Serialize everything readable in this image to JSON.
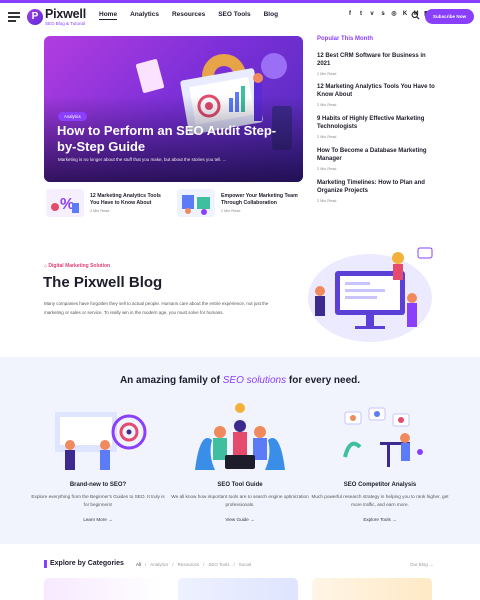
{
  "header": {
    "logo_letter": "P",
    "logo_name": "Pixwell",
    "logo_tagline": "SEO Blog & Tutorial",
    "nav": [
      "Home",
      "Analytics",
      "Resources",
      "SEO Tools",
      "Blog"
    ],
    "social_icons": [
      "facebook-icon",
      "twitter-icon",
      "vimeo-icon",
      "skype-icon",
      "instagram-icon",
      "vk-icon",
      "medium-icon",
      "grid-icon"
    ],
    "social_glyphs": [
      "f",
      "t",
      "v",
      "s",
      "◎",
      "K",
      "M",
      "▦"
    ],
    "subscribe_label": "Subscribe Now",
    "accent": "#8a3ffc"
  },
  "hero": {
    "tag": "Analytics",
    "title": "How to Perform an SEO Audit Step-by-Step Guide",
    "excerpt": "Marketing is no longer about the stuff that you make, but about the stories you tell. ..."
  },
  "mini_posts": [
    {
      "title": "12 Marketing Analytics Tools You Have to Know About",
      "meta": "2 Min Read"
    },
    {
      "title": "Empower Your Marketing Team Through Collaboration",
      "meta": "2 Min Read"
    }
  ],
  "popular": {
    "heading": "Popular This Month",
    "items": [
      {
        "title": "12 Best CRM Software for Business in 2021",
        "meta": "2 Min Read"
      },
      {
        "title": "12 Marketing Analytics Tools You Have to Know About",
        "meta": "2 Min Read"
      },
      {
        "title": "9 Habits of Highly Effective Marketing Technologists",
        "meta": "2 Min Read"
      },
      {
        "title": "How To Become a Database Marketing Manager",
        "meta": "2 Min Read"
      },
      {
        "title": "Marketing Timelines: How to Plan and Organize Projects",
        "meta": "2 Min Read"
      }
    ]
  },
  "blog_intro": {
    "kicker": "Digital Marketing Solution",
    "title": "The Pixwell Blog",
    "description": "Many companies have forgotten they sell to actual people. Humans care about the entire experience, not just the marketing or sales or service. To really win in the modern age, you must solve for humans."
  },
  "solutions": {
    "title_pre": "An amazing family of ",
    "title_em": "SEO solutions",
    "title_post": " for every need.",
    "items": [
      {
        "title": "Brand-new to SEO?",
        "desc": "Explore everything from the Beginner's Guides to SEO. It truly is for beginners!",
        "link": "Learn More →"
      },
      {
        "title": "SEO Tool Guide",
        "desc": "We all know how important tools are to search engine optimization professionals.",
        "link": "View Guide →"
      },
      {
        "title": "SEO Competitor Analysis",
        "desc": "Much powerful research strategy in helping you to rank higher, get more traffic, and earn more.",
        "link": "Explore Tools →"
      }
    ]
  },
  "categories": {
    "title": "Explore by Categories",
    "items": [
      "All",
      "Analytics",
      "Resources",
      "SEO Tools",
      "Social"
    ],
    "separator": "/",
    "more": "Our Blog →"
  }
}
